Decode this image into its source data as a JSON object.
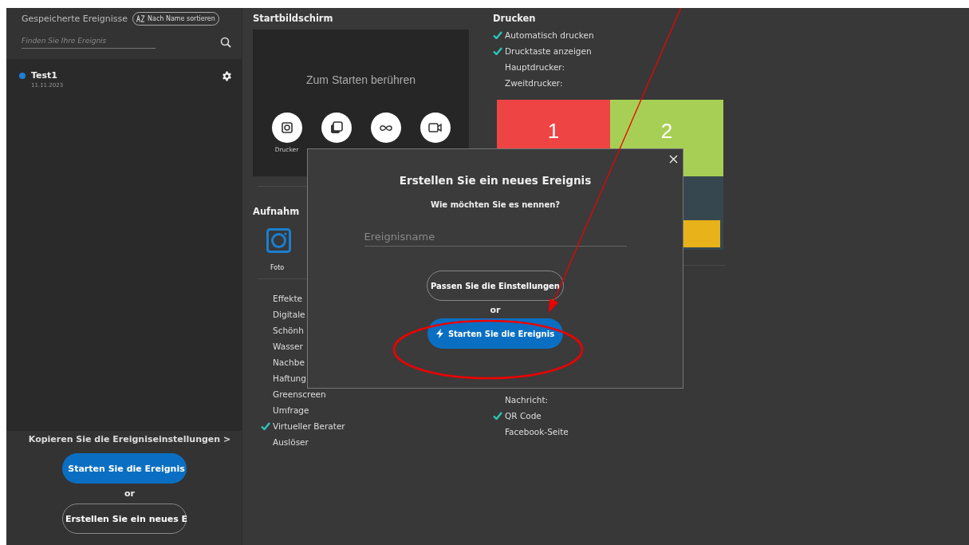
{
  "sidebar": {
    "title": "Gespeicherte Ereignisse",
    "sort_button": "Nach Name sortieren",
    "search": {
      "placeholder": "Finden Sie Ihre Ereignis"
    },
    "events": [
      {
        "name": "Test1",
        "date": "11.11.2023",
        "color": "#1e7fd8"
      }
    ],
    "copy_link": "Kopieren Sie die Ereigniseinstellungen >",
    "start_button": "Starten Sie die Ereignis",
    "or": "or",
    "create_button": "Erstellen Sie ein neues E"
  },
  "start_screen": {
    "title": "Startbildschirm",
    "prompt": "Zum Starten berühren",
    "modes": [
      {
        "kind": "photo",
        "label": "Drucker"
      },
      {
        "kind": "gif"
      },
      {
        "kind": "boomerang"
      },
      {
        "kind": "video"
      }
    ]
  },
  "capture": {
    "title": "Aufnahm",
    "mode_label": "Foto",
    "options": [
      {
        "label": "Effekte",
        "checked": false
      },
      {
        "label": "Digitale",
        "checked": false
      },
      {
        "label": "Schönh",
        "checked": false
      },
      {
        "label": "Wasser",
        "checked": false
      },
      {
        "label": "Nachbe",
        "checked": false
      },
      {
        "label": "Haftung",
        "checked": false
      },
      {
        "label": "Greenscreen",
        "checked": false
      },
      {
        "label": "Umfrage",
        "checked": false
      },
      {
        "label": "Virtueller Berater",
        "checked": true
      },
      {
        "label": "Auslöser",
        "checked": false
      }
    ]
  },
  "print": {
    "title": "Drucken",
    "options": [
      {
        "label": "Automatisch drucken",
        "checked": true
      },
      {
        "label": "Drucktaste anzeigen",
        "checked": true
      },
      {
        "label": "Hauptdrucker:",
        "checked": false
      },
      {
        "label": "Zweitdrucker:",
        "checked": false
      }
    ],
    "layout": {
      "tiles": [
        {
          "label": "1",
          "color": "#ef4444"
        },
        {
          "label": "2",
          "color": "#a8cf55"
        }
      ]
    }
  },
  "share": {
    "options": [
      {
        "label": "Nachricht:",
        "checked": false
      },
      {
        "label": "QR Code",
        "checked": true
      },
      {
        "label": "Facebook-Seite",
        "checked": false
      }
    ]
  },
  "dialog": {
    "title": "Erstellen Sie ein neues Ereignis",
    "question": "Wie möchten Sie es nennen?",
    "name_field": {
      "placeholder": "Ereignisname"
    },
    "customize_button": "Passen Sie die Einstellungen",
    "or": "or",
    "start_button": "Starten Sie die Ereignis"
  }
}
